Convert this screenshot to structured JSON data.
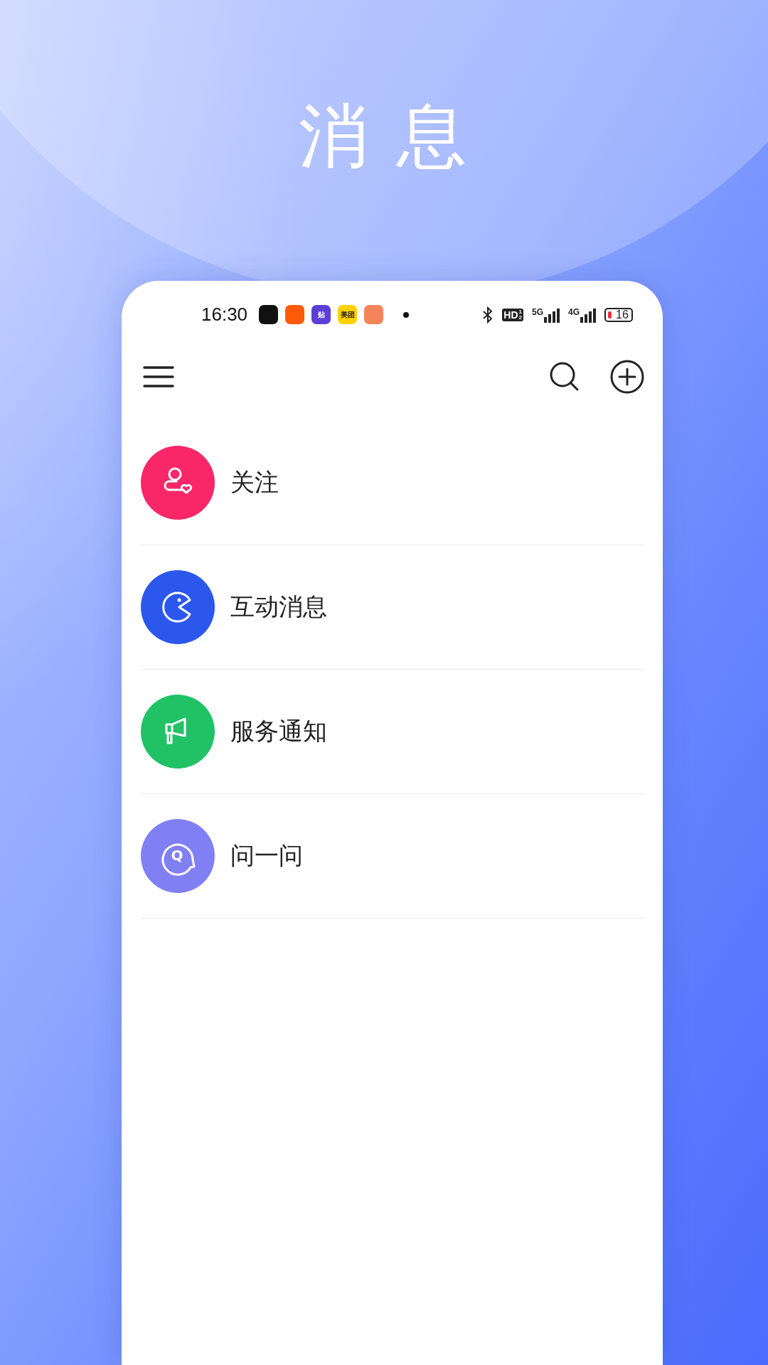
{
  "headline": "消 息",
  "status_bar": {
    "time": "16:30",
    "notifications": [
      {
        "kind": "app",
        "color": "#111111"
      },
      {
        "kind": "app",
        "color": "#ff5a0a"
      },
      {
        "kind": "app",
        "color": "#5b3fd6",
        "label": "贴"
      },
      {
        "kind": "app",
        "color": "#ffd100",
        "label": "美团"
      },
      {
        "kind": "app",
        "color": "#f6845a"
      },
      {
        "kind": "dot"
      }
    ],
    "hd": {
      "label": "HD",
      "sup": "1",
      "sub": "2"
    },
    "network_1": "5G",
    "network_2": "4G",
    "battery": "16"
  },
  "items": [
    {
      "kind": "follow",
      "label": "关注",
      "color": "#fa2768"
    },
    {
      "kind": "interact",
      "label": "互动消息",
      "color": "#2b57ed"
    },
    {
      "kind": "service",
      "label": "服务通知",
      "color": "#20c265"
    },
    {
      "kind": "ask",
      "label": "问一问",
      "color": "#8080f4",
      "glyph": "Q"
    }
  ]
}
